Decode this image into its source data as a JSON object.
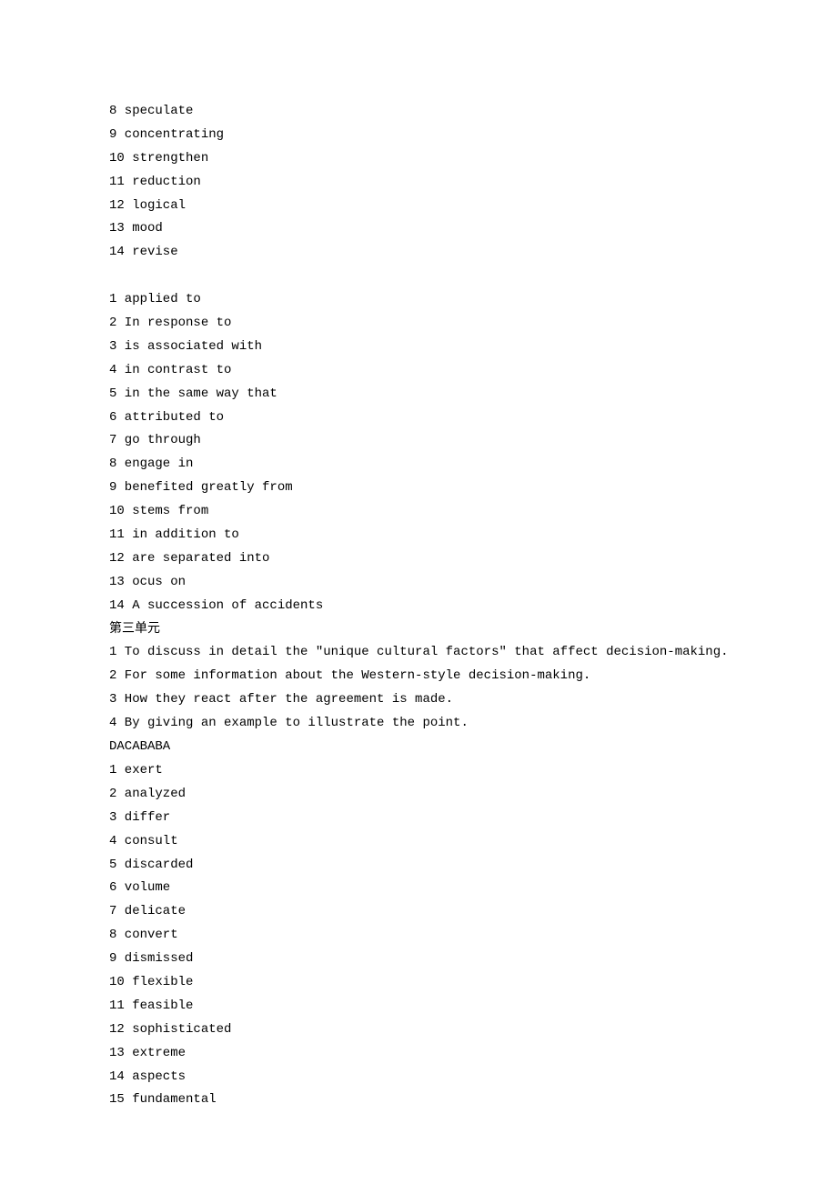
{
  "block1": [
    "8 speculate",
    "9 concentrating",
    "10 strengthen",
    "11 reduction",
    "12 logical",
    "13 mood",
    "14 revise"
  ],
  "block2": [
    "1 applied to",
    "2 In response to",
    "3 is associated with",
    "4 in contrast to",
    "5 in the same way that",
    "6 attributed to",
    "7 go through",
    "8 engage in",
    "9 benefited greatly from",
    "10 stems from",
    "11 in addition to",
    "12 are separated into",
    "13 ocus on",
    "14 A succession of accidents"
  ],
  "unit3_heading": "第三单元",
  "unit3_questions": [
    "1 To discuss in detail the \"unique cultural factors\" that affect decision-making.",
    "2 For some information about the Western-style decision-making.",
    "3 How they react after the agreement is made.",
    "4 By giving an example to illustrate the point."
  ],
  "unit3_answers_code": "DACABABA",
  "block3": [
    "1 exert",
    "2 analyzed",
    "3 differ",
    "4 consult",
    "5 discarded",
    "6 volume",
    "7 delicate",
    "8 convert",
    "9 dismissed",
    "10 flexible",
    "11 feasible",
    "12 sophisticated",
    "13 extreme",
    "14 aspects",
    "15 fundamental"
  ]
}
